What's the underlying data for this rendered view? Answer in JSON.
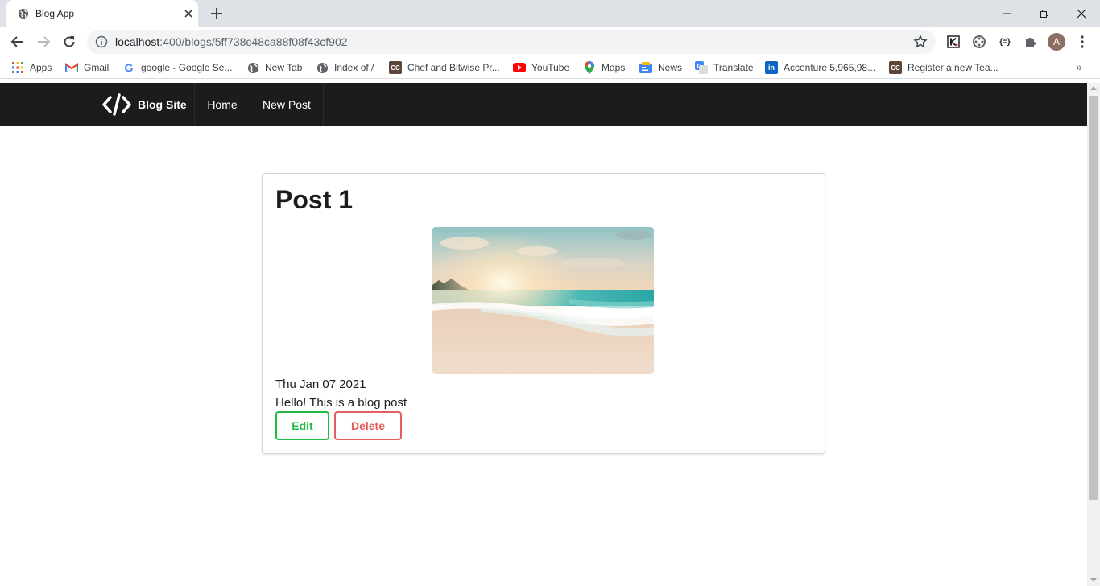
{
  "browser": {
    "tab": {
      "title": "Blog App",
      "favicon": "globe-icon",
      "close_icon": "close-icon"
    },
    "new_tab_icon": "plus-icon",
    "url": {
      "host": "localhost",
      "rest": ":400/blogs/5ff738c48ca88f08f43cf902"
    },
    "avatar_letter": "A",
    "bookmarks": [
      {
        "label": "Apps",
        "icon": "apps-grid-icon"
      },
      {
        "label": "Gmail",
        "icon": "gmail-icon"
      },
      {
        "label": "google - Google Se...",
        "icon": "google-icon"
      },
      {
        "label": "New Tab",
        "icon": "globe-icon"
      },
      {
        "label": "Index of /",
        "icon": "globe-icon"
      },
      {
        "label": "Chef and Bitwise Pr...",
        "icon": "codechef-icon"
      },
      {
        "label": "YouTube",
        "icon": "youtube-icon"
      },
      {
        "label": "Maps",
        "icon": "maps-icon"
      },
      {
        "label": "News",
        "icon": "news-icon"
      },
      {
        "label": "Translate",
        "icon": "translate-icon"
      },
      {
        "label": "Accenture 5,965,98...",
        "icon": "linkedin-icon"
      },
      {
        "label": "Register a new Tea...",
        "icon": "codechef-icon"
      }
    ],
    "more_bookmarks": "»"
  },
  "site": {
    "brand": "Blog Site",
    "nav": [
      "Home",
      "New Post"
    ]
  },
  "post": {
    "title": "Post 1",
    "date": "Thu Jan 07 2021",
    "body": "Hello! This is a blog post",
    "edit_label": "Edit",
    "delete_label": "Delete"
  },
  "colors": {
    "navbar": "#1b1c1d",
    "edit": "#21ba45",
    "delete": "#db2828"
  }
}
